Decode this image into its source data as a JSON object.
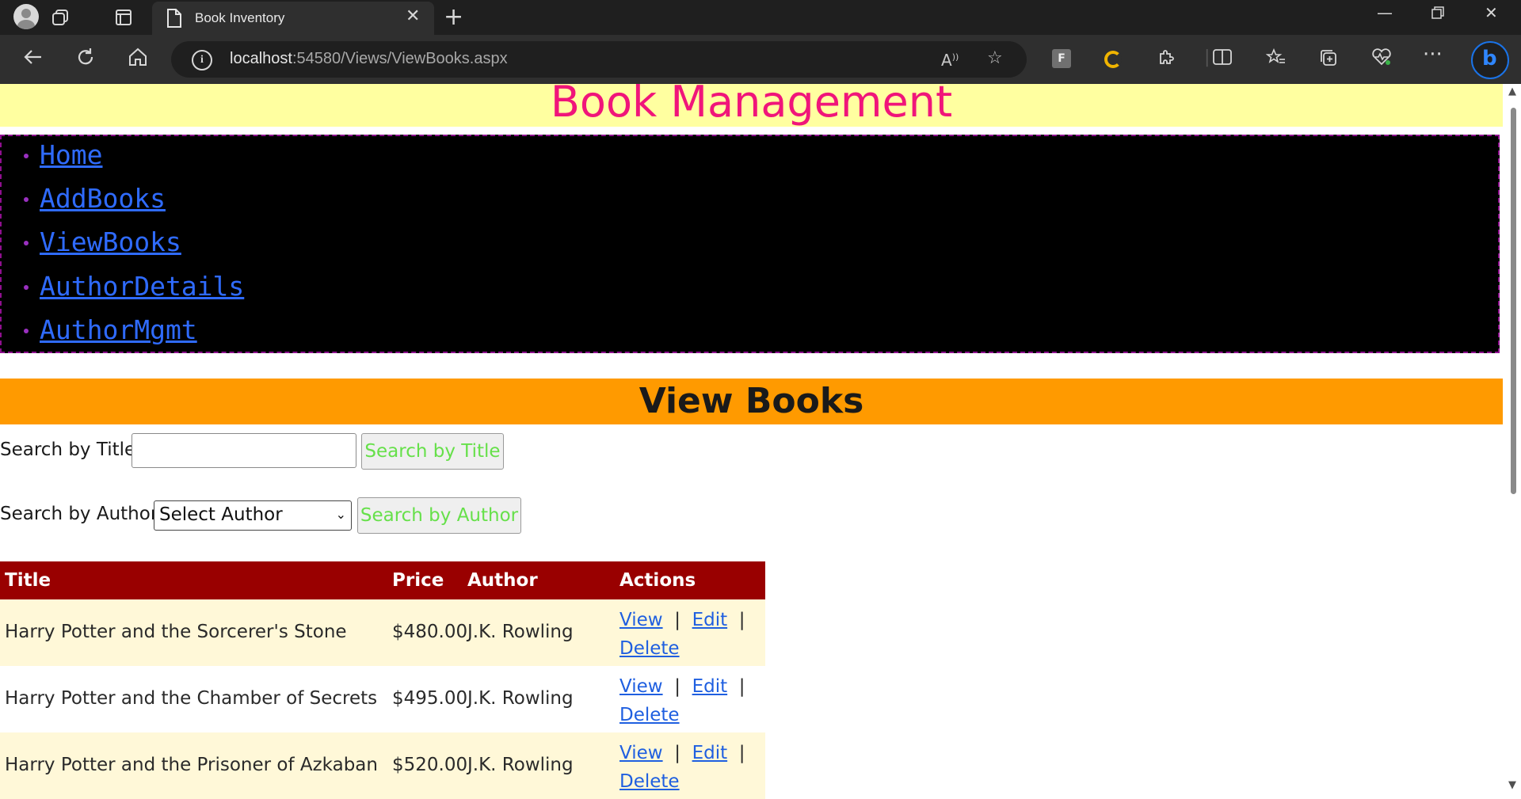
{
  "browser": {
    "tab_title": "Book Inventory",
    "url_host": "localhost",
    "url_path": ":54580/Views/ViewBooks.aspx",
    "new_tab_symbol": "+",
    "ext_f_label": "F"
  },
  "site": {
    "title": "Book Management"
  },
  "nav": {
    "items": [
      {
        "label": "Home"
      },
      {
        "label": "AddBooks"
      },
      {
        "label": "ViewBooks"
      },
      {
        "label": "AuthorDetails"
      },
      {
        "label": "AuthorMgmt"
      }
    ]
  },
  "page": {
    "heading": "View Books",
    "search_title_label": "Search by Title:",
    "search_title_value": "",
    "search_title_button": "Search by Title",
    "search_author_label": "Search by Author:",
    "search_author_selected": "Select Author",
    "search_author_button": "Search by Author"
  },
  "table": {
    "headers": {
      "title": "Title",
      "price": "Price",
      "author": "Author",
      "actions": "Actions"
    },
    "rows": [
      {
        "title": "Harry Potter and the Sorcerer's Stone",
        "price": "$480.00",
        "author": "J.K. Rowling"
      },
      {
        "title": "Harry Potter and the Chamber of Secrets",
        "price": "$495.00",
        "author": "J.K. Rowling"
      },
      {
        "title": "Harry Potter and the Prisoner of Azkaban",
        "price": "$520.00",
        "author": "J.K. Rowling"
      }
    ],
    "action_labels": {
      "view": "View",
      "edit": "Edit",
      "delete": "Delete",
      "separator": "|"
    }
  },
  "colors": {
    "header_bg": "#ffffa0",
    "title_color": "#f0157a",
    "nav_bg": "#000000",
    "nav_border": "#8e0f8e",
    "link_color": "#2f6bff",
    "section_bg": "#ff9a00",
    "button_text": "#66e04a",
    "table_header_bg": "#990000",
    "row_alt_bg": "#fff8d8"
  },
  "icons": {
    "profile": "profile-icon",
    "workspaces": "workspaces-icon",
    "tab_actions": "tab-actions-icon",
    "page": "page-icon",
    "close_tab": "close-icon",
    "back": "back-arrow-icon",
    "refresh": "refresh-icon",
    "home": "home-icon",
    "info": "info-icon",
    "read_aloud": "read-aloud-icon",
    "favorite": "star-icon",
    "extensions": "puzzle-icon",
    "split_screen": "split-screen-icon",
    "favorites_list": "favorites-icon",
    "collections": "collections-icon",
    "health": "heartbeat-icon",
    "more": "more-icon",
    "copilot": "bing-icon"
  }
}
